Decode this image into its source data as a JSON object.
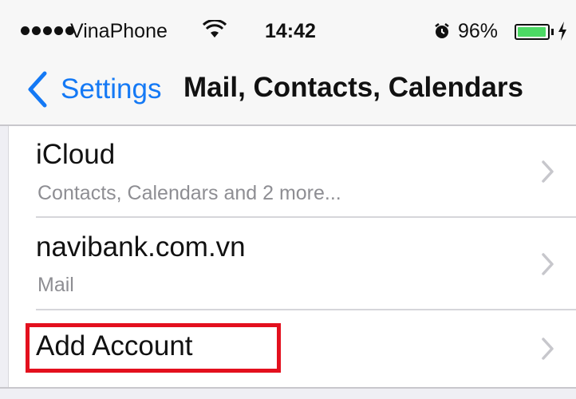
{
  "status_bar": {
    "carrier": "VinaPhone",
    "time": "14:42",
    "battery_percent": "96%",
    "battery_level": 0.96,
    "battery_color": "#4cd964",
    "icons": [
      "signal-dots-icon",
      "wifi-icon",
      "alarm-clock-icon",
      "battery-icon",
      "charging-bolt-icon"
    ]
  },
  "nav": {
    "back_label": "Settings",
    "title": "Mail, Contacts, Calendars",
    "accent_color": "#1479f5"
  },
  "accounts": [
    {
      "title": "iCloud",
      "subtitle": "Contacts, Calendars and 2 more..."
    },
    {
      "title": "navibank.com.vn",
      "subtitle": "Mail"
    },
    {
      "title": "Add Account",
      "subtitle": ""
    }
  ],
  "annotation": {
    "highlight_color": "#e3101e",
    "highlighted_item": "Add Account"
  }
}
